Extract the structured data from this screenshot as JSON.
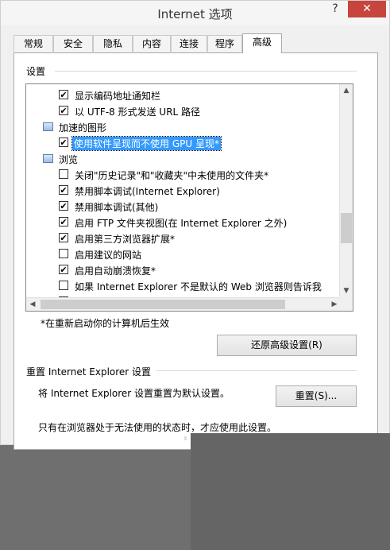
{
  "window": {
    "title": "Internet 选项",
    "help_label": "?",
    "close_label": "✕"
  },
  "tabs": [
    {
      "label": "常规",
      "active": false
    },
    {
      "label": "安全",
      "active": false
    },
    {
      "label": "隐私",
      "active": false
    },
    {
      "label": "内容",
      "active": false
    },
    {
      "label": "连接",
      "active": false
    },
    {
      "label": "程序",
      "active": false
    },
    {
      "label": "高级",
      "active": true
    }
  ],
  "settings": {
    "label": "设置",
    "items": [
      {
        "type": "checkbox",
        "label": "显示编码地址通知栏",
        "checked": true
      },
      {
        "type": "checkbox",
        "label": "以 UTF-8 形式发送 URL 路径",
        "checked": true
      },
      {
        "type": "category",
        "label": "加速的图形",
        "icon": "graphics-icon"
      },
      {
        "type": "checkbox",
        "label": "使用软件呈现而不使用 GPU 呈现*",
        "checked": true,
        "selected": true
      },
      {
        "type": "category",
        "label": "浏览",
        "icon": "browse-icon"
      },
      {
        "type": "checkbox",
        "label": "关闭\"历史记录\"和\"收藏夹\"中未使用的文件夹*",
        "checked": false
      },
      {
        "type": "checkbox",
        "label": "禁用脚本调试(Internet Explorer)",
        "checked": true
      },
      {
        "type": "checkbox",
        "label": "禁用脚本调试(其他)",
        "checked": true
      },
      {
        "type": "checkbox",
        "label": "启用 FTP 文件夹视图(在 Internet Explorer 之外)",
        "checked": true
      },
      {
        "type": "checkbox",
        "label": "启用第三方浏览器扩展*",
        "checked": true
      },
      {
        "type": "checkbox",
        "label": "启用建议的网站",
        "checked": false
      },
      {
        "type": "checkbox",
        "label": "启用自动崩溃恢复*",
        "checked": true
      },
      {
        "type": "checkbox",
        "label": "如果 Internet Explorer 不是默认的 Web 浏览器则告诉我",
        "checked": false
      },
      {
        "type": "checkbox",
        "label": "…………",
        "checked": false
      }
    ]
  },
  "restart_note": "*在重新启动你的计算机后生效",
  "restore_button": "还原高级设置(R)",
  "reset_section": {
    "label": "重置 Internet Explorer 设置",
    "description": "将 Internet Explorer 设置重置为默认设置。",
    "button": "重置(S)...",
    "note": "只有在浏览器处于无法使用的状态时，才应使用此设置。"
  },
  "colors": {
    "selection": "#3399ff",
    "close": "#c7453c",
    "overlay": "#6f6f6f"
  }
}
